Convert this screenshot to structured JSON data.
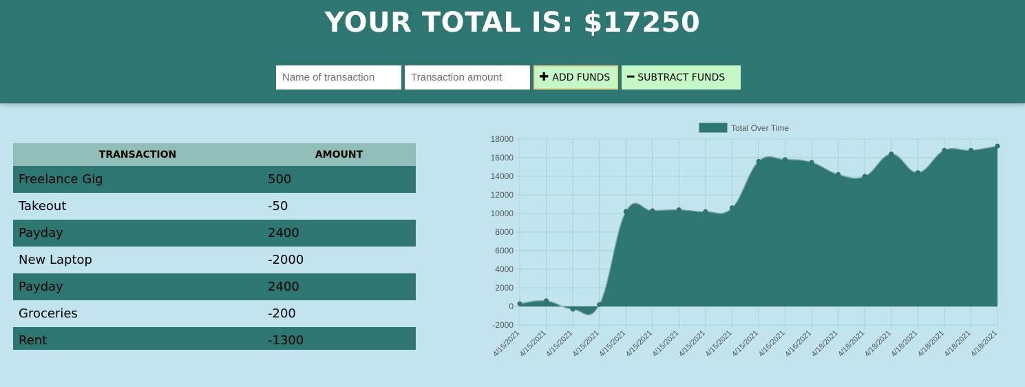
{
  "header": {
    "total_text": "YOUR TOTAL IS: $17250"
  },
  "form": {
    "name_placeholder": "Name of transaction",
    "amount_placeholder": "Transaction amount",
    "add_label": "ADD FUNDS",
    "add_icon": "plus-icon",
    "subtract_label": "SUBTRACT FUNDS",
    "subtract_icon": "minus-icon"
  },
  "table": {
    "headers": [
      "TRANSACTION",
      "AMOUNT"
    ],
    "rows": [
      {
        "name": "Freelance Gig",
        "amount": "500"
      },
      {
        "name": "Takeout",
        "amount": "-50"
      },
      {
        "name": "Payday",
        "amount": "2400"
      },
      {
        "name": "New Laptop",
        "amount": "-2000"
      },
      {
        "name": "Payday",
        "amount": "2400"
      },
      {
        "name": "Groceries",
        "amount": "-200"
      },
      {
        "name": "Rent",
        "amount": "-1300"
      }
    ]
  },
  "colors": {
    "accent": "#2d7672",
    "background": "#c1e4ef",
    "button": "#c6f7c6"
  },
  "chart_data": {
    "type": "area",
    "legend": "Total Over Time",
    "legend_position": "top",
    "grid": true,
    "ylim": [
      -2000,
      18000
    ],
    "yticks": [
      -2000,
      0,
      2000,
      4000,
      6000,
      8000,
      10000,
      12000,
      14000,
      16000,
      18000
    ],
    "x": [
      "4/15/2021",
      "4/15/2021",
      "4/15/2021",
      "4/15/2021",
      "4/15/2021",
      "4/15/2021",
      "4/15/2021",
      "4/15/2021",
      "4/15/2021",
      "4/15/2021",
      "4/16/2021",
      "4/16/2021",
      "4/18/2021",
      "4/18/2021",
      "4/18/2021",
      "4/18/2021",
      "4/18/2021",
      "4/18/2021",
      "4/18/2021"
    ],
    "series": [
      {
        "name": "Total Over Time",
        "values": [
          300,
          600,
          -300,
          200,
          10200,
          10300,
          10400,
          10200,
          10600,
          15600,
          15800,
          15500,
          14200,
          14000,
          16400,
          14400,
          16800,
          16800,
          17250
        ]
      }
    ]
  }
}
